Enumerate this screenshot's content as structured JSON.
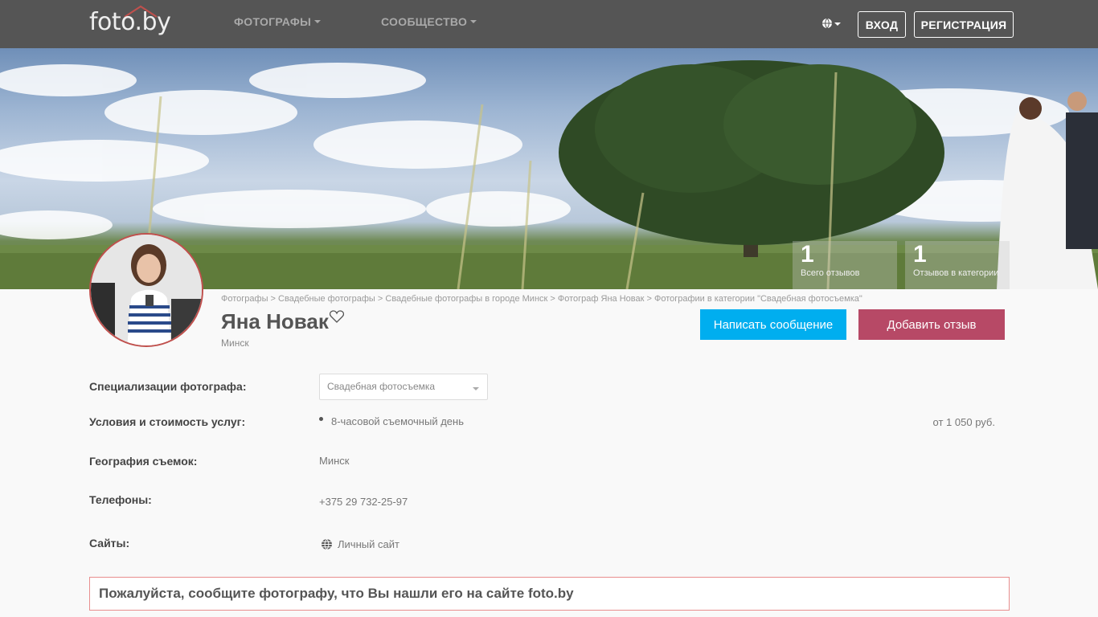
{
  "header": {
    "logo_text": "foto.by",
    "nav": [
      {
        "label": "ФОТОГРАФЫ"
      },
      {
        "label": "СООБЩЕСТВО"
      }
    ],
    "login_label": "ВХОД",
    "register_label": "РЕГИСТРАЦИЯ"
  },
  "stats": [
    {
      "value": "1",
      "label": "Всего отзывов"
    },
    {
      "value": "1",
      "label": "Отзывов в категории"
    }
  ],
  "breadcrumb": [
    "Фотографы",
    "Свадебные фотографы",
    "Свадебные фотографы в городе Минск",
    "Фотограф Яна Новак",
    "Фотографии в категории \"Свадебная фотосъемка\""
  ],
  "breadcrumb_separator": " > ",
  "profile": {
    "name": "Яна Новак",
    "city": "Минск"
  },
  "actions": {
    "message_label": "Написать сообщение",
    "review_label": "Добавить отзыв"
  },
  "details": {
    "specializations_label": "Специализации фотографа:",
    "specialization_selected": "Свадебная фотосъемка",
    "services_label": "Условия и стоимость услуг:",
    "service_item": "8-часовой съемочный день",
    "service_price": "от 1 050 руб.",
    "geography_label": "География съемок:",
    "geography_value": "Минск",
    "phones_label": "Телефоны:",
    "phone_value": "+375 29 732-25-97",
    "sites_label": "Сайты:",
    "site_link": "Личный сайт"
  },
  "notice": "Пожалуйста, сообщите фотографу, что Вы нашли его на сайте foto.by",
  "colors": {
    "topbar": "#555555",
    "message_button": "#00aeef",
    "review_button": "#b74966",
    "notice_border": "#e88e8e"
  }
}
